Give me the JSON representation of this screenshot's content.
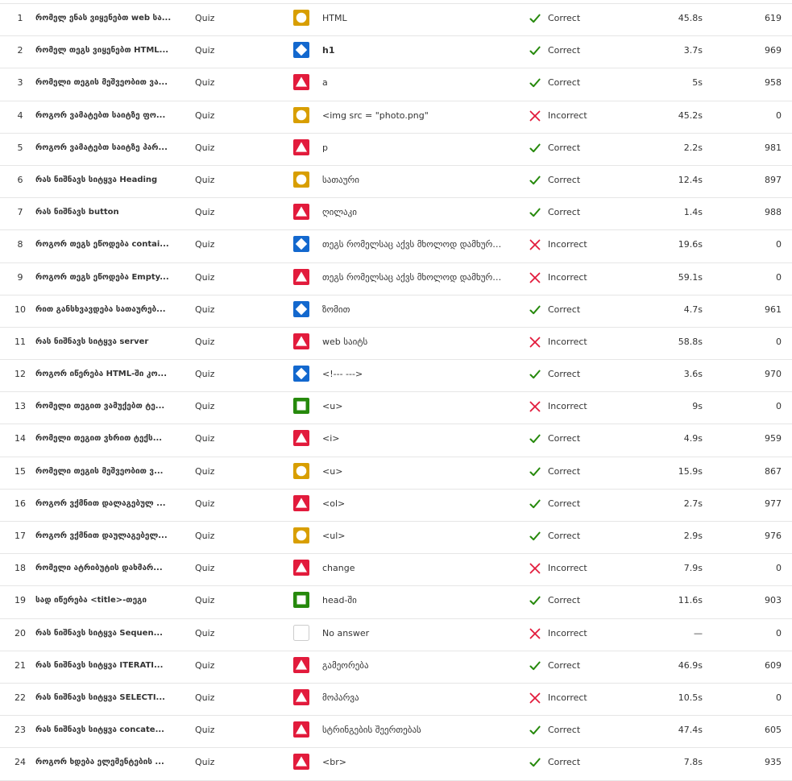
{
  "colors": {
    "circle": "#d89e00",
    "diamond": "#1368ce",
    "triangle": "#e21b3c",
    "square": "#26890c",
    "none": "#cccccc",
    "correct": "#26890c",
    "incorrect": "#e21b3c"
  },
  "rows": [
    {
      "num": "1",
      "question": "რომელ ენას ვიყენებთ web სა...",
      "type": "Quiz",
      "shape": "circle",
      "answer": "HTML",
      "result": "correct",
      "result_label": "Correct",
      "time": "45.8s",
      "points": "619"
    },
    {
      "num": "2",
      "question": "რომელ თეგს ვიყენებთ HTML...",
      "type": "Quiz",
      "shape": "diamond",
      "answer": "h1",
      "answer_bold": true,
      "result": "correct",
      "result_label": "Correct",
      "time": "3.7s",
      "points": "969"
    },
    {
      "num": "3",
      "question": "რომელი თეგის მეშვეობით ვა...",
      "type": "Quiz",
      "shape": "triangle",
      "answer": "a",
      "result": "correct",
      "result_label": "Correct",
      "time": "5s",
      "points": "958"
    },
    {
      "num": "4",
      "question": "როგორ ვამატებთ საიტზე ფო...",
      "type": "Quiz",
      "shape": "circle",
      "answer": "<img src = \"photo.png\"",
      "result": "incorrect",
      "result_label": "Incorrect",
      "time": "45.2s",
      "points": "0"
    },
    {
      "num": "5",
      "question": "როგორ ვამატებთ საიტზე პარ...",
      "type": "Quiz",
      "shape": "triangle",
      "answer": "p",
      "result": "correct",
      "result_label": "Correct",
      "time": "2.2s",
      "points": "981"
    },
    {
      "num": "6",
      "question": "რას ნიშნავს სიტყვა Heading",
      "type": "Quiz",
      "shape": "circle",
      "answer": "სათაური",
      "result": "correct",
      "result_label": "Correct",
      "time": "12.4s",
      "points": "897"
    },
    {
      "num": "7",
      "question": "რას ნიშნავს button",
      "type": "Quiz",
      "shape": "triangle",
      "answer": "ღილაკი",
      "result": "correct",
      "result_label": "Correct",
      "time": "1.4s",
      "points": "988"
    },
    {
      "num": "8",
      "question": "როგორ თეგს ეწოდება contai...",
      "type": "Quiz",
      "shape": "diamond",
      "answer": "თეგს რომელსაც აქვს მხოლოდ დამხურა...",
      "result": "incorrect",
      "result_label": "Incorrect",
      "time": "19.6s",
      "points": "0"
    },
    {
      "num": "9",
      "question": "როგორ თეგს ეწოდება Empty...",
      "type": "Quiz",
      "shape": "triangle",
      "answer": "თეგს რომელსაც აქვს მხოლოდ დამხურა...",
      "result": "incorrect",
      "result_label": "Incorrect",
      "time": "59.1s",
      "points": "0"
    },
    {
      "num": "10",
      "question": "რით განსხვავდება სათაურებ...",
      "type": "Quiz",
      "shape": "diamond",
      "answer": "ზომით",
      "result": "correct",
      "result_label": "Correct",
      "time": "4.7s",
      "points": "961"
    },
    {
      "num": "11",
      "question": "რას ნიშნავს სიტყვა server",
      "type": "Quiz",
      "shape": "triangle",
      "answer": "web საიტს",
      "result": "incorrect",
      "result_label": "Incorrect",
      "time": "58.8s",
      "points": "0"
    },
    {
      "num": "12",
      "question": "როგორ იწერება HTML-ში კო...",
      "type": "Quiz",
      "shape": "diamond",
      "answer": "<!--- --->",
      "result": "correct",
      "result_label": "Correct",
      "time": "3.6s",
      "points": "970"
    },
    {
      "num": "13",
      "question": "რომელი თეგით ვამუქებთ ტე...",
      "type": "Quiz",
      "shape": "square",
      "answer": "<u>",
      "result": "incorrect",
      "result_label": "Incorrect",
      "time": "9s",
      "points": "0"
    },
    {
      "num": "14",
      "question": "რომელი თეგით ვხრით ტექს...",
      "type": "Quiz",
      "shape": "triangle",
      "answer": "<i>",
      "result": "correct",
      "result_label": "Correct",
      "time": "4.9s",
      "points": "959"
    },
    {
      "num": "15",
      "question": "რომელი თეგის მეშვეობით ვ...",
      "type": "Quiz",
      "shape": "circle",
      "answer": "<u>",
      "result": "correct",
      "result_label": "Correct",
      "time": "15.9s",
      "points": "867"
    },
    {
      "num": "16",
      "question": "როგორ ვქმნით დალაგებულ ...",
      "type": "Quiz",
      "shape": "triangle",
      "answer": "<ol>",
      "result": "correct",
      "result_label": "Correct",
      "time": "2.7s",
      "points": "977"
    },
    {
      "num": "17",
      "question": "როგორ ვქმნით დაულაგებელ...",
      "type": "Quiz",
      "shape": "circle",
      "answer": "<ul>",
      "result": "correct",
      "result_label": "Correct",
      "time": "2.9s",
      "points": "976"
    },
    {
      "num": "18",
      "question": "რომელი ატრიბუტის დახმარ...",
      "type": "Quiz",
      "shape": "triangle",
      "answer": "change",
      "result": "incorrect",
      "result_label": "Incorrect",
      "time": "7.9s",
      "points": "0"
    },
    {
      "num": "19",
      "question": "სად იწერება <title>-თეგი",
      "type": "Quiz",
      "shape": "square",
      "answer": "head-ში",
      "result": "correct",
      "result_label": "Correct",
      "time": "11.6s",
      "points": "903"
    },
    {
      "num": "20",
      "question": "რას ნიშნავს სიტყვა Sequen...",
      "type": "Quiz",
      "shape": "none",
      "answer": "No answer",
      "result": "incorrect",
      "result_label": "Incorrect",
      "time": "—",
      "points": "0"
    },
    {
      "num": "21",
      "question": "რას ნიშნავს სიტყვა ITERATI...",
      "type": "Quiz",
      "shape": "triangle",
      "answer": "გამეორება",
      "result": "correct",
      "result_label": "Correct",
      "time": "46.9s",
      "points": "609"
    },
    {
      "num": "22",
      "question": "რას ნიშნავს სიტყვა SELECTI...",
      "type": "Quiz",
      "shape": "triangle",
      "answer": "მოპარვა",
      "result": "incorrect",
      "result_label": "Incorrect",
      "time": "10.5s",
      "points": "0"
    },
    {
      "num": "23",
      "question": "რას ნიშნავს სიტყვა concate...",
      "type": "Quiz",
      "shape": "triangle",
      "answer": "სტრინგების შეერთებას",
      "result": "correct",
      "result_label": "Correct",
      "time": "47.4s",
      "points": "605"
    },
    {
      "num": "24",
      "question": "როგორ ხდება ელემენტების ...",
      "type": "Quiz",
      "shape": "triangle",
      "answer": "<br>",
      "result": "correct",
      "result_label": "Correct",
      "time": "7.8s",
      "points": "935"
    }
  ]
}
